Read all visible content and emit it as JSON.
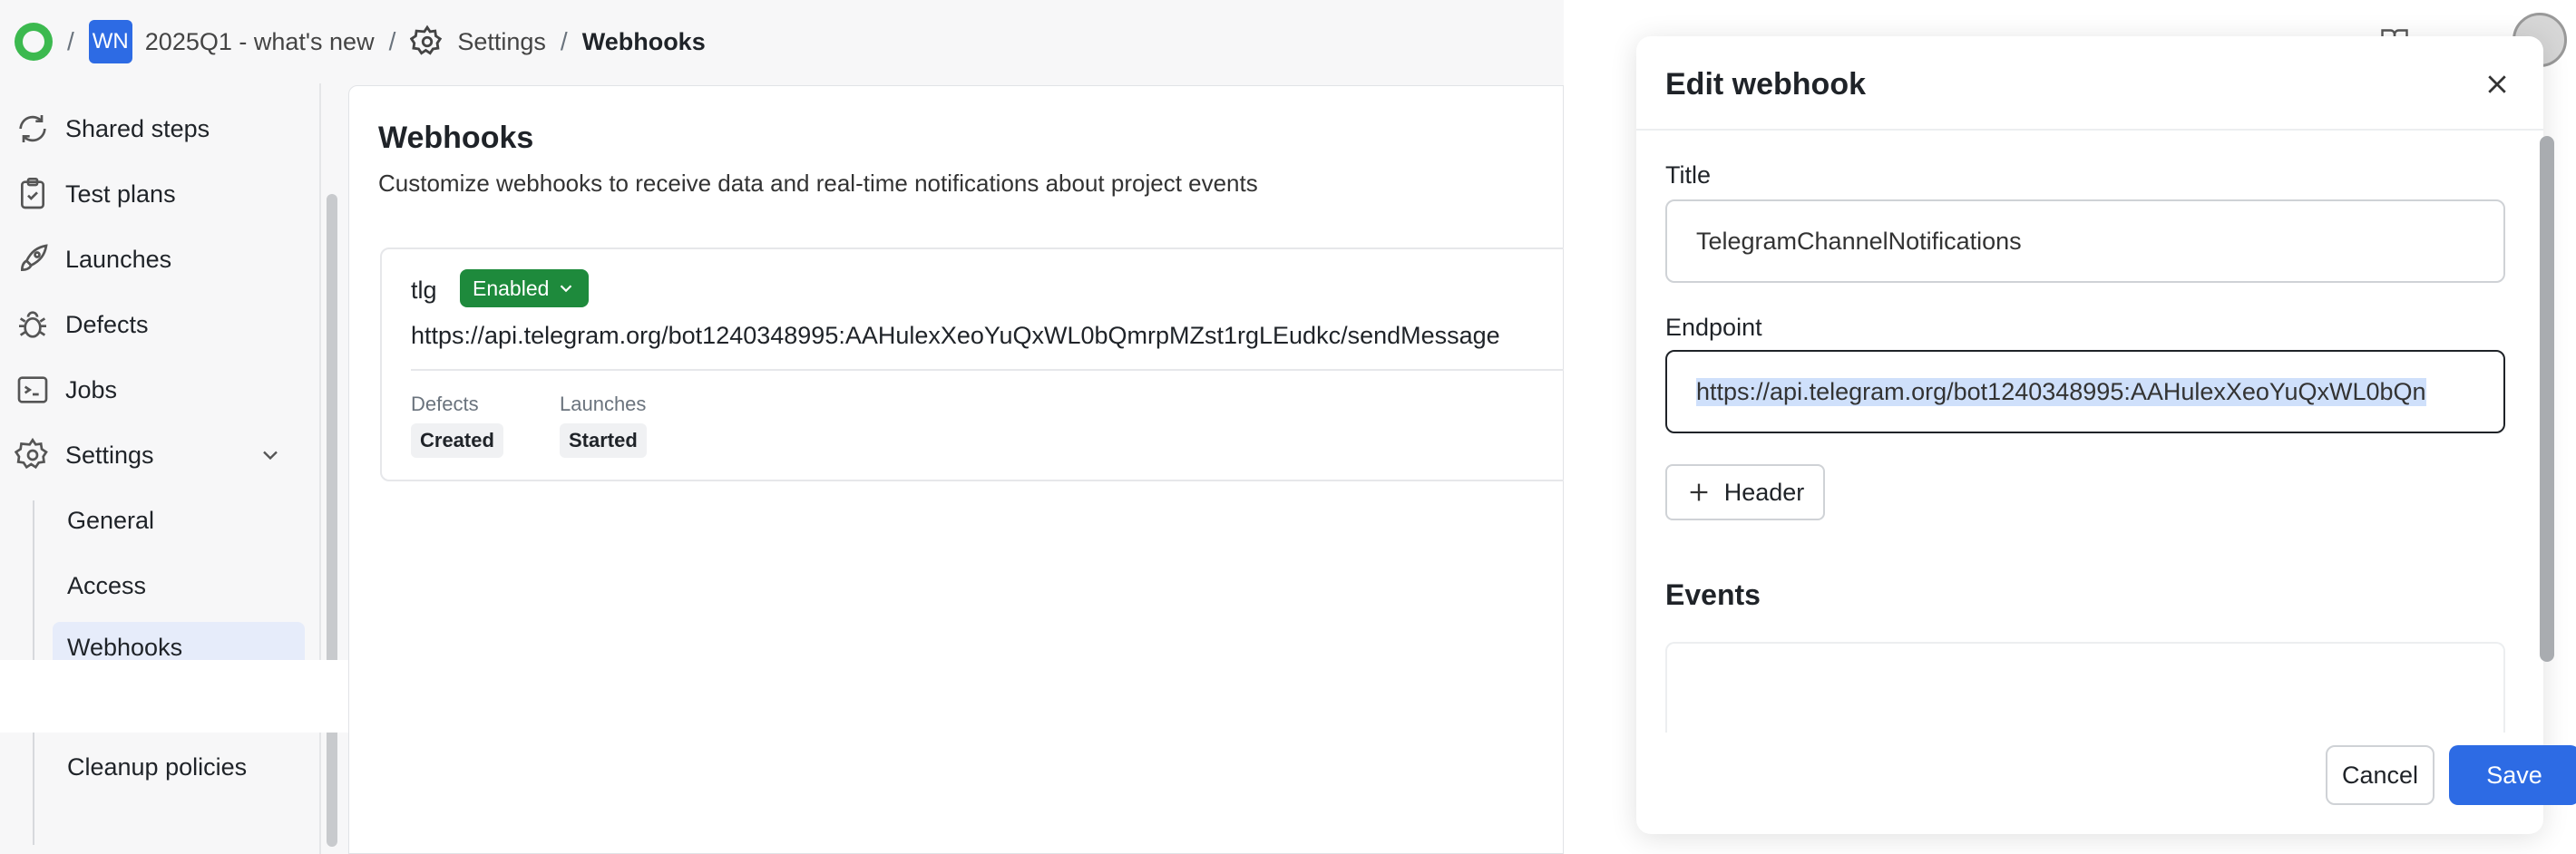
{
  "breadcrumb": {
    "project_initials": "WN",
    "project_name": "2025Q1 - what's new",
    "settings": "Settings",
    "current": "Webhooks"
  },
  "sidebar": {
    "items": [
      {
        "label": "Shared steps",
        "icon": "shared-steps-icon"
      },
      {
        "label": "Test plans",
        "icon": "clipboard-icon"
      },
      {
        "label": "Launches",
        "icon": "rocket-icon"
      },
      {
        "label": "Defects",
        "icon": "bug-icon"
      },
      {
        "label": "Jobs",
        "icon": "terminal-icon"
      },
      {
        "label": "Settings",
        "icon": "gear-icon"
      }
    ],
    "sub_items": [
      "General",
      "Access",
      "Webhooks",
      "Cleanup policies"
    ]
  },
  "main": {
    "title": "Webhooks",
    "description": "Customize webhooks to receive data and real-time notifications about project events",
    "webhook": {
      "name": "tlg",
      "status": "Enabled",
      "url": "https://api.telegram.org/bot1240348995:AAHulexXeoYuQxWL0bQmrpMZst1rgLEudkc/sendMessage",
      "events": [
        {
          "label": "Defects",
          "value": "Created"
        },
        {
          "label": "Launches",
          "value": "Started"
        }
      ]
    }
  },
  "drawer": {
    "title": "Edit webhook",
    "title_label": "Title",
    "title_value": "TelegramChannelNotifications",
    "endpoint_label": "Endpoint",
    "endpoint_value": "https://api.telegram.org/bot1240348995:AAHulexXeoYuQxWL0bQn",
    "header_button": "Header",
    "events_title": "Events",
    "cancel": "Cancel",
    "save": "Save"
  },
  "colors": {
    "accent": "#2d6be4",
    "enabled": "#1e8a3c",
    "logo": "#3cb94f"
  }
}
